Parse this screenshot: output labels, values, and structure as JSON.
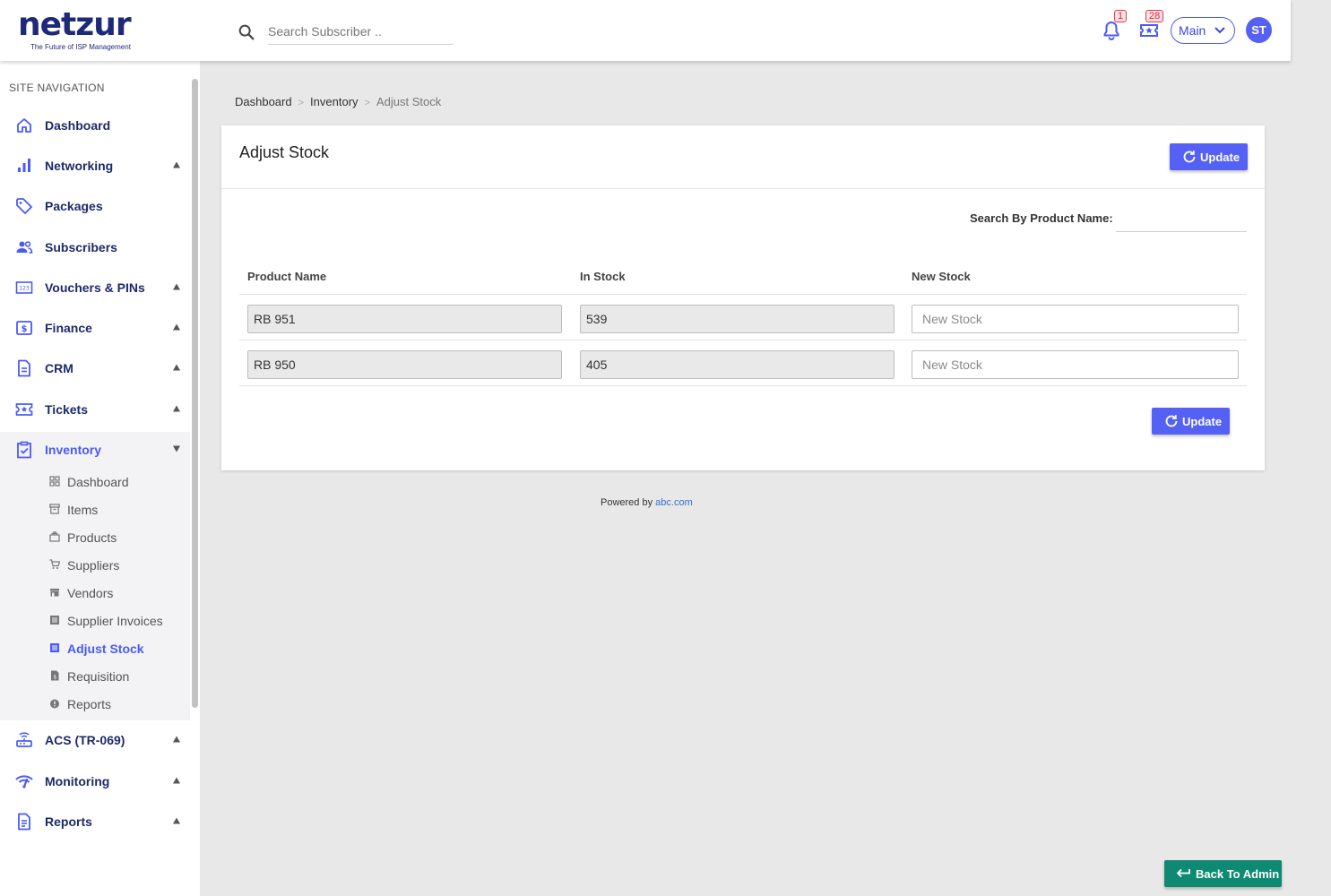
{
  "brand": {
    "name": "netzur",
    "tagline": "The Future of ISP Management"
  },
  "search": {
    "placeholder": "Search Subscriber .."
  },
  "header": {
    "notification_count": "1",
    "ticket_count": "28",
    "context_select": "Main",
    "avatar_initials": "ST"
  },
  "sidebar": {
    "heading": "SITE NAVIGATION",
    "items": [
      {
        "label": "Dashboard",
        "icon": "home-icon"
      },
      {
        "label": "Networking",
        "icon": "bar-chart-icon",
        "caret": "up"
      },
      {
        "label": "Packages",
        "icon": "tag-icon"
      },
      {
        "label": "Subscribers",
        "icon": "users-icon"
      },
      {
        "label": "Vouchers & PINs",
        "icon": "pin-pad-icon",
        "caret": "up"
      },
      {
        "label": "Finance",
        "icon": "dollar-card-icon",
        "caret": "up"
      },
      {
        "label": "CRM",
        "icon": "document-icon",
        "caret": "up"
      },
      {
        "label": "Tickets",
        "icon": "ticket-icon",
        "caret": "up"
      },
      {
        "label": "Inventory",
        "icon": "clipboard-check-icon",
        "caret": "down"
      },
      {
        "label": "ACS (TR-069)",
        "icon": "router-icon",
        "caret": "up"
      },
      {
        "label": "Monitoring",
        "icon": "wifi-signal-icon",
        "caret": "up"
      },
      {
        "label": "Reports",
        "icon": "report-icon",
        "caret": "up"
      }
    ],
    "inventory_sub": [
      {
        "label": "Dashboard",
        "icon": "grid-icon"
      },
      {
        "label": "Items",
        "icon": "archive-icon"
      },
      {
        "label": "Products",
        "icon": "layers-icon"
      },
      {
        "label": "Suppliers",
        "icon": "cart-icon"
      },
      {
        "label": "Vendors",
        "icon": "store-icon"
      },
      {
        "label": "Supplier Invoices",
        "icon": "list-icon"
      },
      {
        "label": "Adjust Stock",
        "icon": "list-icon",
        "active": true
      },
      {
        "label": "Requisition",
        "icon": "file-dollar-icon"
      },
      {
        "label": "Reports",
        "icon": "info-circle-icon"
      }
    ]
  },
  "breadcrumb": {
    "items": [
      "Dashboard",
      "Inventory"
    ],
    "current": "Adjust Stock"
  },
  "card": {
    "title": "Adjust Stock",
    "update_label": "Update",
    "filter_label": "Search By Product Name:",
    "columns": [
      "Product Name",
      "In Stock",
      "New Stock"
    ],
    "rows": [
      {
        "product": "RB 951",
        "in_stock": "539",
        "new_stock_placeholder": "New Stock"
      },
      {
        "product": "RB 950",
        "in_stock": "405",
        "new_stock_placeholder": "New Stock"
      }
    ]
  },
  "footer": {
    "powered_prefix": "Powered by",
    "powered_link": "abc.com"
  },
  "back_button": {
    "label": "Back To Admin"
  },
  "colors": {
    "primary": "#5561f5",
    "nav_text": "#1e2a6b",
    "back_button": "#0e8a72",
    "badge": "#e03a4e"
  }
}
